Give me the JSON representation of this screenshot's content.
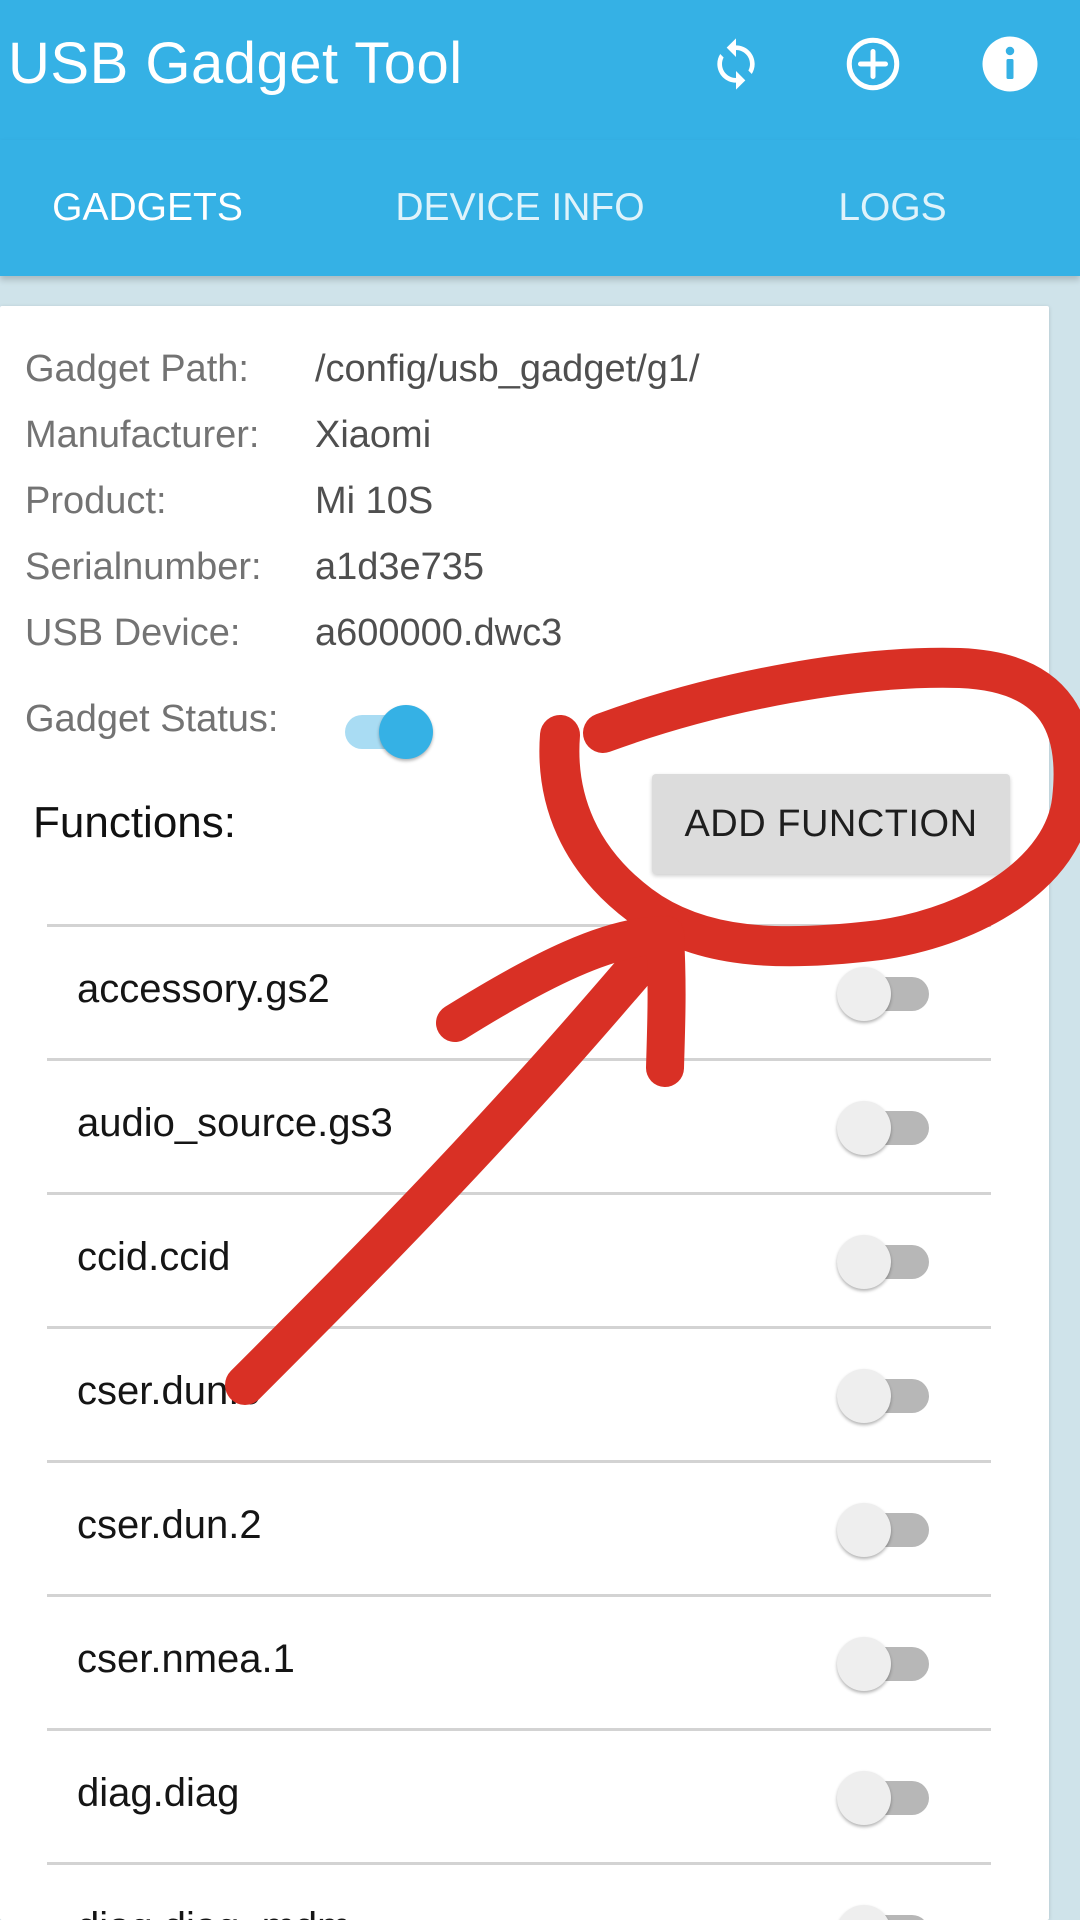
{
  "app": {
    "title": "USB Gadget Tool",
    "accent_color": "#35b1e5",
    "actions": [
      {
        "icon": "refresh-icon"
      },
      {
        "icon": "add-circle-icon"
      },
      {
        "icon": "info-icon"
      }
    ]
  },
  "tabs": [
    {
      "label": "GADGETS",
      "active": true
    },
    {
      "label": "DEVICE INFO",
      "active": false
    },
    {
      "label": "LOGS",
      "active": false
    }
  ],
  "gadget": {
    "path_label": "Gadget Path:",
    "path_value": "/config/usb_gadget/g1/",
    "manufacturer_label": "Manufacturer:",
    "manufacturer_value": "Xiaomi",
    "product_label": "Product:",
    "product_value": "Mi 10S",
    "serial_label": "Serialnumber:",
    "serial_value": "a1d3e735",
    "usb_device_label": "USB Device:",
    "usb_device_value": "a600000.dwc3",
    "status_label": "Gadget Status:",
    "status_on": true
  },
  "functions": {
    "label": "Functions:",
    "add_button": "ADD FUNCTION",
    "items": [
      {
        "name": "accessory.gs2",
        "enabled": false
      },
      {
        "name": "audio_source.gs3",
        "enabled": false
      },
      {
        "name": "ccid.ccid",
        "enabled": false
      },
      {
        "name": "cser.dun.0",
        "enabled": false
      },
      {
        "name": "cser.dun.2",
        "enabled": false
      },
      {
        "name": "cser.nmea.1",
        "enabled": false
      },
      {
        "name": "diag.diag",
        "enabled": false
      },
      {
        "name": "diag.diag_mdm",
        "enabled": false
      }
    ]
  },
  "annotation": {
    "color": "#d93025"
  }
}
